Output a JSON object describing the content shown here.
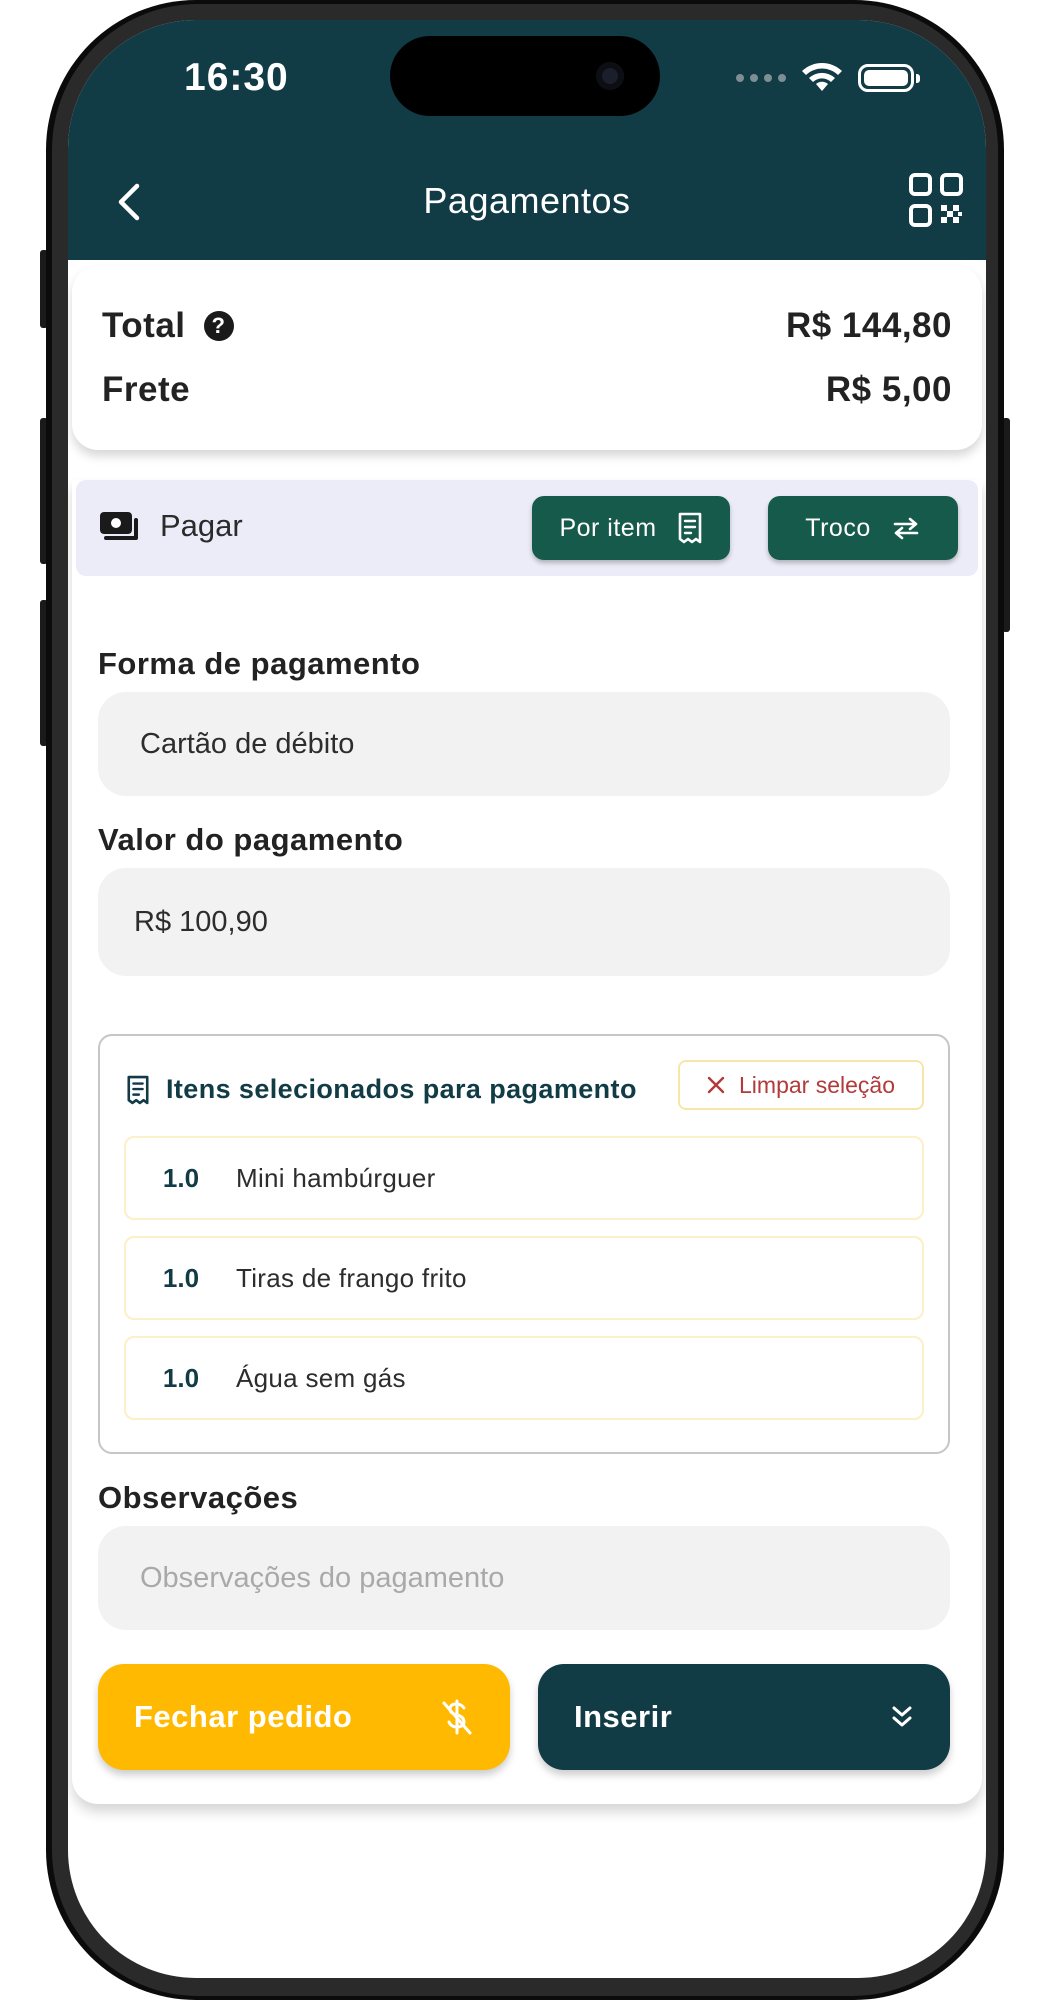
{
  "status_bar": {
    "time": "16:30"
  },
  "header": {
    "title": "Pagamentos"
  },
  "totals": {
    "total_label": "Total",
    "total_value": "R$ 144,80",
    "frete_label": "Frete",
    "frete_value": "R$ 5,00"
  },
  "pay_bar": {
    "label": "Pagar",
    "por_item_label": "Por item",
    "troco_label": "Troco"
  },
  "payment_method": {
    "label": "Forma de pagamento",
    "value": "Cartão de débito"
  },
  "payment_value": {
    "label": "Valor do pagamento",
    "value": "R$ 100,90"
  },
  "selected_items": {
    "title": "Itens selecionados para pagamento",
    "clear_label": "Limpar seleção",
    "items": [
      {
        "qty": "1.0",
        "name": "Mini hambúrguer"
      },
      {
        "qty": "1.0",
        "name": "Tiras de frango frito"
      },
      {
        "qty": "1.0",
        "name": "Água sem gás"
      }
    ]
  },
  "observations": {
    "label": "Observações",
    "placeholder": "Observações do pagamento"
  },
  "actions": {
    "close_label": "Fechar pedido",
    "insert_label": "Inserir"
  },
  "colors": {
    "header": "#113b45",
    "primary_green": "#165a4b",
    "accent_yellow": "#ffb900",
    "danger": "#b23a3a"
  }
}
